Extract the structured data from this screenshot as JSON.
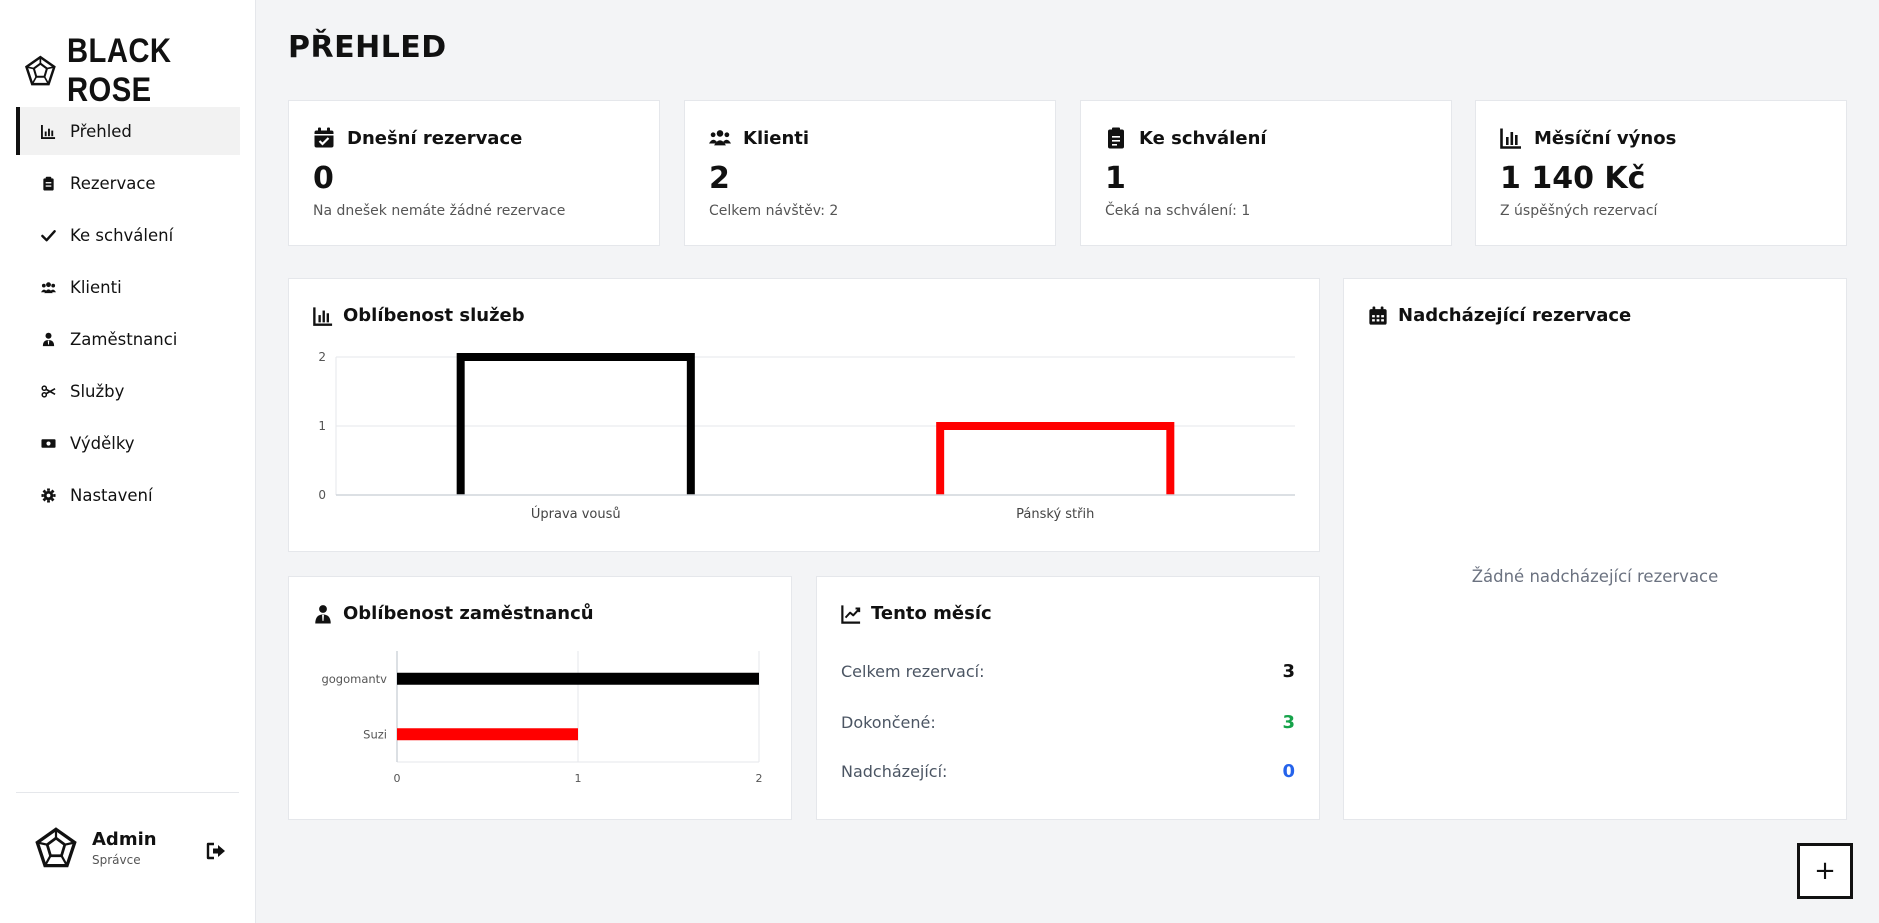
{
  "brand": {
    "name": "BLACK ROSE"
  },
  "sidebar": {
    "items": [
      {
        "label": "Přehled",
        "icon": "chart-bar-icon",
        "active": true
      },
      {
        "label": "Rezervace",
        "icon": "clipboard-icon",
        "active": false
      },
      {
        "label": "Ke schválení",
        "icon": "check-icon",
        "active": false
      },
      {
        "label": "Klienti",
        "icon": "users-icon",
        "active": false
      },
      {
        "label": "Zaměstnanci",
        "icon": "user-tie-icon",
        "active": false
      },
      {
        "label": "Služby",
        "icon": "scissors-icon",
        "active": false
      },
      {
        "label": "Výdělky",
        "icon": "money-icon",
        "active": false
      },
      {
        "label": "Nastavení",
        "icon": "gear-icon",
        "active": false
      }
    ]
  },
  "user": {
    "name": "Admin",
    "role": "Správce"
  },
  "page": {
    "title": "PŘEHLED"
  },
  "stats": [
    {
      "title": "Dnešní rezervace",
      "value": "0",
      "sub": "Na dnešek nemáte žádné rezervace",
      "icon": "calendar-check-icon"
    },
    {
      "title": "Klienti",
      "value": "2",
      "sub": "Celkem návštěv: 2",
      "icon": "users-icon"
    },
    {
      "title": "Ke schválení",
      "value": "1",
      "sub": "Čeká na schválení: 1",
      "icon": "clipboard-icon"
    },
    {
      "title": "Měsíční výnos",
      "value": "1 140 Kč",
      "sub": "Z úspěšných rezervací",
      "icon": "chart-bar-icon"
    }
  ],
  "services_card": {
    "title": "Oblíbenost služeb"
  },
  "employees_card": {
    "title": "Oblíbenost zaměstnanců"
  },
  "month_card": {
    "title": "Tento měsíc",
    "rows": [
      {
        "label": "Celkem rezervací:",
        "value": "3",
        "color": "#111111"
      },
      {
        "label": "Dokončené:",
        "value": "3",
        "color": "#16a34a"
      },
      {
        "label": "Nadcházející:",
        "value": "0",
        "color": "#2563eb"
      }
    ]
  },
  "upcoming_card": {
    "title": "Nadcházející rezervace",
    "empty": "Žádné nadcházející rezervace"
  },
  "fab": {
    "label": "+"
  },
  "colors": {
    "black_series": "#000000",
    "red_series": "#ff0000"
  },
  "chart_data": [
    {
      "type": "bar",
      "orientation": "vertical",
      "categories": [
        "Úprava vousů",
        "Pánský střih"
      ],
      "values": [
        2,
        1
      ],
      "colors": [
        "#000000",
        "#ff0000"
      ],
      "ylim": [
        0,
        2
      ],
      "yticks": [
        "0",
        "1",
        "2"
      ],
      "grid": true
    },
    {
      "type": "bar",
      "orientation": "horizontal",
      "categories": [
        "gogomantv",
        "Suzi"
      ],
      "values": [
        2,
        1
      ],
      "colors": [
        "#000000",
        "#ff0000"
      ],
      "xlim": [
        0,
        2
      ],
      "xticks": [
        "0",
        "1",
        "2"
      ],
      "grid": true
    }
  ]
}
